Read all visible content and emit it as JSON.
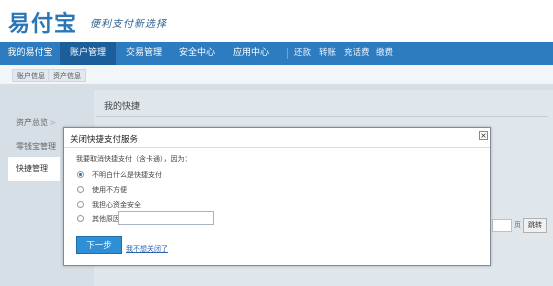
{
  "header": {
    "logo": "易付宝",
    "slogan": "便利支付新选择"
  },
  "nav": {
    "items": [
      "我的易付宝",
      "账户管理",
      "交易管理",
      "安全中心",
      "应用中心"
    ],
    "sub_items": [
      "还款",
      "转账",
      "充话费",
      "缴费"
    ],
    "active_index": 1
  },
  "breadcrumb": {
    "items": [
      "账户信息",
      "资产信息"
    ]
  },
  "sidebar": {
    "items": [
      "资产总览",
      "零钱宝管理",
      "快捷管理"
    ],
    "active_index": 2
  },
  "main": {
    "title": "我的快捷",
    "pager_unit": "页",
    "pager_button": "跳转"
  },
  "modal": {
    "title": "关闭快捷支付服务",
    "question": "我要取消快捷支付（含卡通），因为：",
    "options": [
      "不明白什么是快捷支付",
      "使用不方便",
      "我担心资金安全",
      "其他原因"
    ],
    "selected_index": 0,
    "other_placeholder": "",
    "next_label": "下一步",
    "cancel_link": "我不想关闭了"
  },
  "colors": {
    "brand": "#2d7cbf",
    "nav_active": "#1b5e99",
    "primary_button": "#2f8fd6",
    "link": "#2b62b0"
  }
}
